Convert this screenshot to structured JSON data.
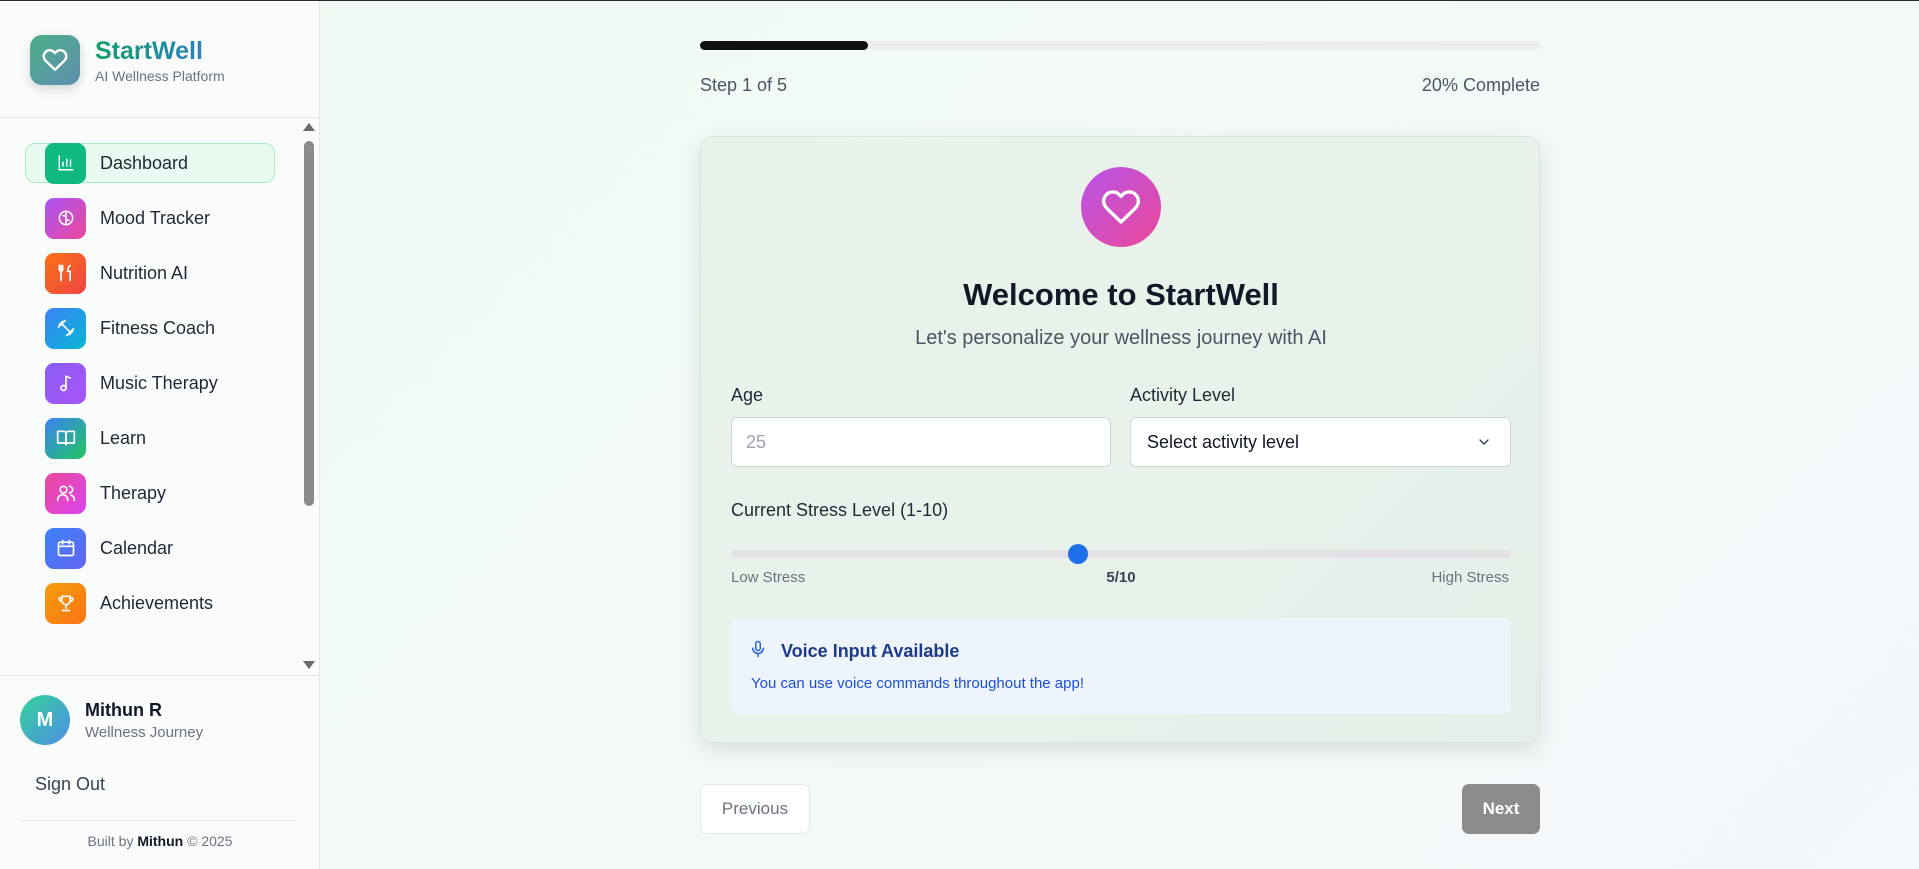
{
  "brand": {
    "title": "StartWell",
    "subtitle": "AI Wellness Platform",
    "icon": "heart-icon"
  },
  "sidebar": {
    "items": [
      {
        "label": "Dashboard",
        "icon": "bar-chart-icon",
        "color": "#10b981",
        "active": true
      },
      {
        "label": "Mood Tracker",
        "icon": "brain-icon",
        "color": "#c04ee0"
      },
      {
        "label": "Nutrition AI",
        "icon": "utensils-icon",
        "color": "#f1543a"
      },
      {
        "label": "Fitness Coach",
        "icon": "dumbbell-icon",
        "color": "#1ca4e6"
      },
      {
        "label": "Music Therapy",
        "icon": "music-note-icon",
        "color": "#8b5cf6"
      },
      {
        "label": "Learn",
        "icon": "book-icon",
        "color": "#2aa6a0"
      },
      {
        "label": "Therapy",
        "icon": "users-icon",
        "color": "#d946a8"
      },
      {
        "label": "Calendar",
        "icon": "calendar-icon",
        "color": "#4f6ff0"
      },
      {
        "label": "Achievements",
        "icon": "trophy-icon",
        "color": "#f59e0b"
      }
    ]
  },
  "user": {
    "initial": "M",
    "name": "Mithun R",
    "subtitle": "Wellness Journey"
  },
  "signout_label": "Sign Out",
  "footer": {
    "prefix": "Built by",
    "author": "Mithun",
    "suffix": "© 2025"
  },
  "progress": {
    "fraction": 0.2,
    "step_text": "Step 1 of 5",
    "percent_text": "20% Complete"
  },
  "card": {
    "title": "Welcome to StartWell",
    "subtitle": "Let's personalize your wellness journey with AI",
    "age": {
      "label": "Age",
      "placeholder": "25",
      "value": ""
    },
    "activity": {
      "label": "Activity Level",
      "selected": "Select activity level"
    },
    "stress": {
      "label": "Current Stress Level (1-10)",
      "min": 1,
      "max": 10,
      "value": 5,
      "value_text": "5/10",
      "low_label": "Low Stress",
      "high_label": "High Stress"
    },
    "voice": {
      "title": "Voice Input Available",
      "text": "You can use voice commands throughout the app!"
    }
  },
  "nav_buttons": {
    "previous": "Previous",
    "next": "Next"
  },
  "colors": {
    "accent": "#10b981",
    "slider": "#1f6feb",
    "next_button": "#8a8c8e"
  }
}
